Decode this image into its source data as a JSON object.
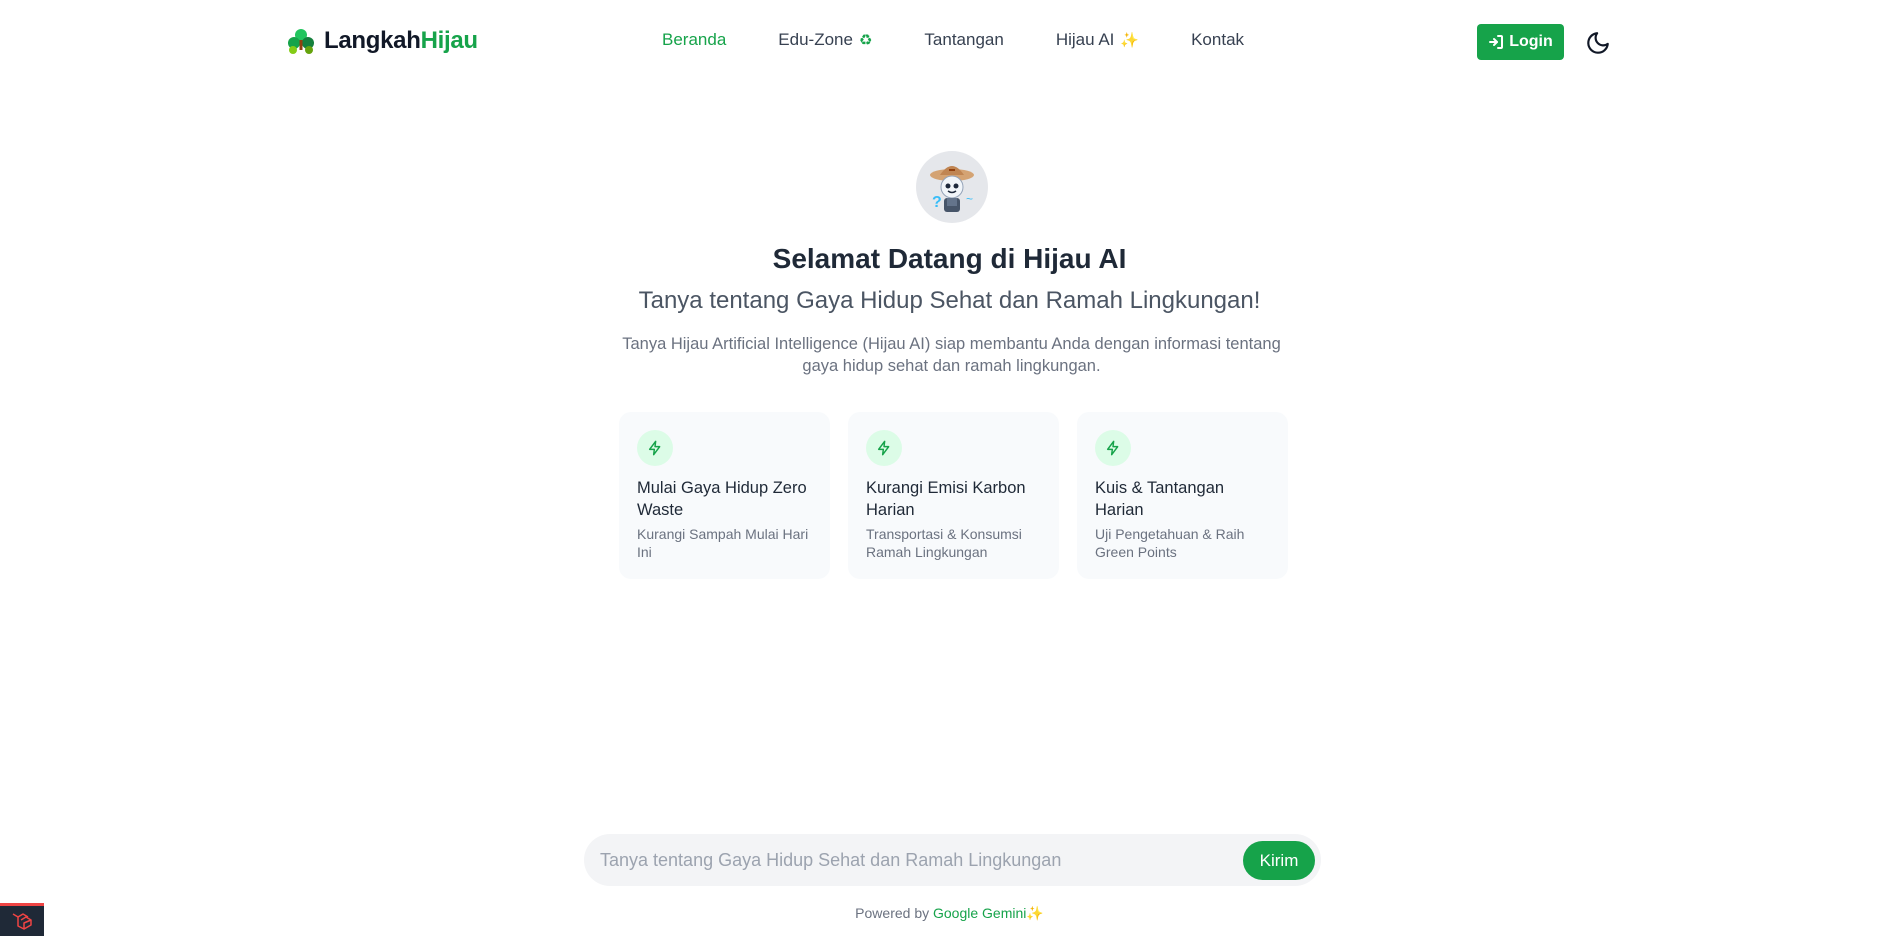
{
  "header": {
    "brand_part1": "Langkah",
    "brand_part2": "Hijau",
    "nav": [
      {
        "label": "Beranda",
        "active": true
      },
      {
        "label": "Edu-Zone",
        "icon": "recycle-icon",
        "glyph": "♻"
      },
      {
        "label": "Tantangan"
      },
      {
        "label": "Hijau AI",
        "icon": "sparkle-icon",
        "glyph": "✨"
      },
      {
        "label": "Kontak"
      }
    ],
    "login_label": "Login"
  },
  "hero": {
    "title": "Selamat Datang di Hijau AI",
    "subtitle": "Tanya tentang Gaya Hidup Sehat dan Ramah Lingkungan!",
    "description": "Tanya Hijau Artificial Intelligence (Hijau AI) siap membantu Anda dengan informasi tentang gaya hidup sehat dan ramah lingkungan."
  },
  "cards": [
    {
      "title": "Mulai Gaya Hidup Zero Waste",
      "subtitle": "Kurangi Sampah Mulai Hari Ini",
      "icon": "lightning-icon"
    },
    {
      "title": "Kurangi Emisi Karbon Harian",
      "subtitle": "Transportasi & Konsumsi Ramah Lingkungan",
      "icon": "lightning-icon"
    },
    {
      "title": "Kuis & Tantangan Harian",
      "subtitle": "Uji Pengetahuan & Raih Green Points",
      "icon": "lightning-icon"
    }
  ],
  "chat": {
    "placeholder": "Tanya tentang Gaya Hidup Sehat dan Ramah Lingkungan",
    "value": "",
    "send_label": "Kirim"
  },
  "footer": {
    "powered_prefix": "Powered by",
    "powered_brand": "Google Gemini",
    "powered_glyph": "✨"
  },
  "colors": {
    "accent": "#16a34a",
    "accent_light": "#dcfce7",
    "sparkle": "#f59e0b",
    "card_bg": "#f8fafc",
    "text_dark": "#1f2937",
    "text_muted": "#6b7280"
  }
}
